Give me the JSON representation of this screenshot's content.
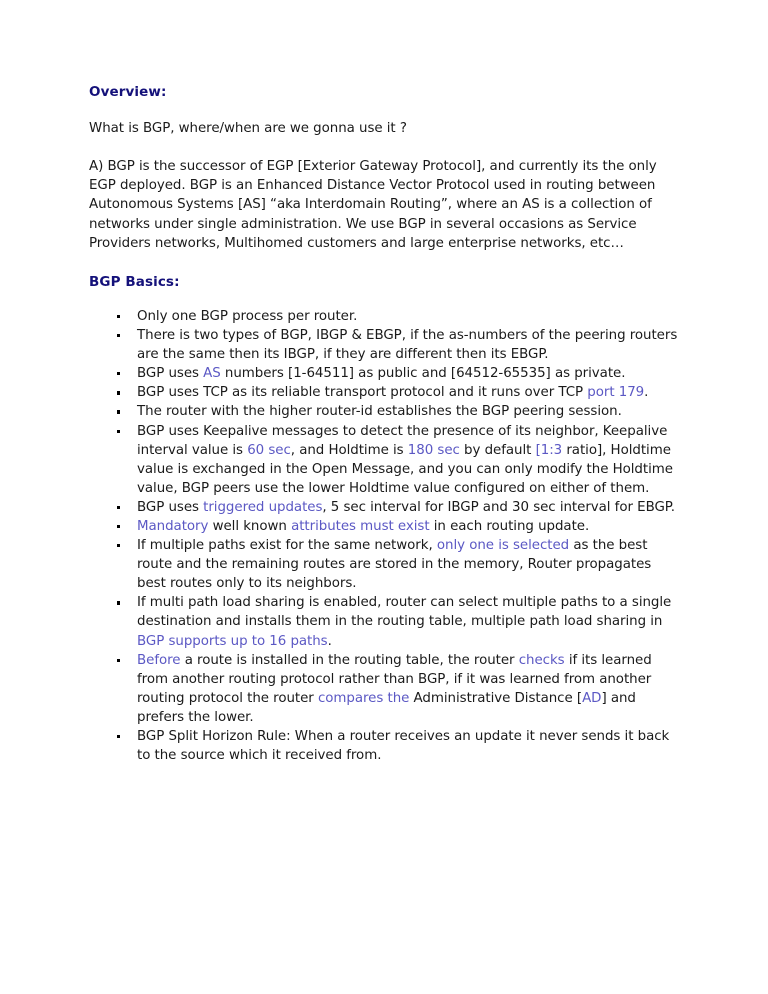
{
  "document": {
    "sections": [
      {
        "heading": "Overview:",
        "paragraphs": [
          "What is BGP, where/when are we gonna use it ?",
          "A) BGP is the successor of EGP [Exterior Gateway Protocol], and currently its the only EGP deployed. BGP is an Enhanced Distance Vector Protocol used in routing between Autonomous Systems [AS] “aka Interdomain Routing”, where an AS is a collection of networks under single administration. We use BGP in several occasions as Service Providers networks, Multihomed customers and large enterprise networks, etc…"
        ]
      },
      {
        "heading": "BGP Basics:",
        "bullets": [
          {
            "id": "bullet-one-process",
            "runs": [
              {
                "text": "Only one BGP process per router.",
                "color": "black"
              }
            ]
          },
          {
            "id": "bullet-ibgp-ebgp",
            "runs": [
              {
                "text": "There is two types of BGP, IBGP & EBGP, if the as-numbers of the peering routers are the same then its IBGP, if they are different then its EBGP.",
                "color": "black"
              }
            ]
          },
          {
            "id": "bullet-as-numbers",
            "runs": [
              {
                "text": "BGP uses ",
                "color": "black"
              },
              {
                "text": "AS",
                "color": "blue"
              },
              {
                "text": " numbers [1-64511] as public and [64512-65535] as private.",
                "color": "black"
              }
            ]
          },
          {
            "id": "bullet-tcp-port",
            "runs": [
              {
                "text": "BGP uses TCP as its reliable transport protocol and it runs over TCP ",
                "color": "black"
              },
              {
                "text": "port 179",
                "color": "blue"
              },
              {
                "text": ".",
                "color": "black"
              }
            ]
          },
          {
            "id": "bullet-router-id",
            "runs": [
              {
                "text": "The router with the higher router-id establishes the BGP peering session.",
                "color": "black"
              }
            ]
          },
          {
            "id": "bullet-keepalive",
            "runs": [
              {
                "text": "BGP uses Keepalive messages to detect the presence of its neighbor, Keepalive interval value is ",
                "color": "black"
              },
              {
                "text": "60 sec",
                "color": "blue"
              },
              {
                "text": ", and Holdtime is ",
                "color": "black"
              },
              {
                "text": "180 sec",
                "color": "blue"
              },
              {
                "text": " by default ",
                "color": "black"
              },
              {
                "text": "[1:3",
                "color": "blue"
              },
              {
                "text": " ratio], Holdtime value is exchanged in the Open Message, and you can only modify the Holdtime value, BGP peers use the lower Holdtime value configured on either of them.",
                "color": "black"
              }
            ]
          },
          {
            "id": "bullet-triggered-updates",
            "runs": [
              {
                "text": "BGP uses ",
                "color": "black"
              },
              {
                "text": "triggered updates",
                "color": "blue"
              },
              {
                "text": ", 5 sec interval for IBGP and 30 sec interval for EBGP.",
                "color": "black"
              }
            ]
          },
          {
            "id": "bullet-mandatory-attributes",
            "runs": [
              {
                "text": "Mandatory",
                "color": "blue"
              },
              {
                "text": " well known ",
                "color": "black"
              },
              {
                "text": "attributes must exist",
                "color": "blue"
              },
              {
                "text": " in each routing update.",
                "color": "black"
              }
            ]
          },
          {
            "id": "bullet-best-route",
            "runs": [
              {
                "text": "If multiple paths exist for the same network, ",
                "color": "black"
              },
              {
                "text": "only one is selected",
                "color": "blue"
              },
              {
                "text": " as the best route and the remaining routes are stored in the memory, Router propagates best routes only to its neighbors.",
                "color": "black"
              }
            ]
          },
          {
            "id": "bullet-multipath",
            "runs": [
              {
                "text": "If multi path load sharing is enabled, router can select multiple paths to a single destination and installs them in the routing table, multiple path load sharing in ",
                "color": "black"
              },
              {
                "text": "BGP supports up to 16 paths",
                "color": "blue"
              },
              {
                "text": ".",
                "color": "black"
              }
            ]
          },
          {
            "id": "bullet-admin-distance",
            "runs": [
              {
                "text": "Before",
                "color": "blue"
              },
              {
                "text": " a route is installed in the routing table, the router ",
                "color": "black"
              },
              {
                "text": "checks",
                "color": "blue"
              },
              {
                "text": " if its learned from another routing protocol rather than BGP, if it was learned from another routing protocol the router ",
                "color": "black"
              },
              {
                "text": "compares the",
                "color": "blue"
              },
              {
                "text": " Administrative Distance [",
                "color": "black"
              },
              {
                "text": "AD",
                "color": "blue"
              },
              {
                "text": "] and prefers the lower.",
                "color": "black"
              }
            ]
          },
          {
            "id": "bullet-split-horizon",
            "runs": [
              {
                "text": "BGP Split Horizon Rule: When a router receives an update it never sends it back to the source which it received from.",
                "color": "black"
              }
            ]
          }
        ]
      }
    ],
    "colors": {
      "heading": "#14117a",
      "accent_blue": "#5b58c4",
      "body_text": "#1a1a1a",
      "background": "#ffffff"
    }
  }
}
